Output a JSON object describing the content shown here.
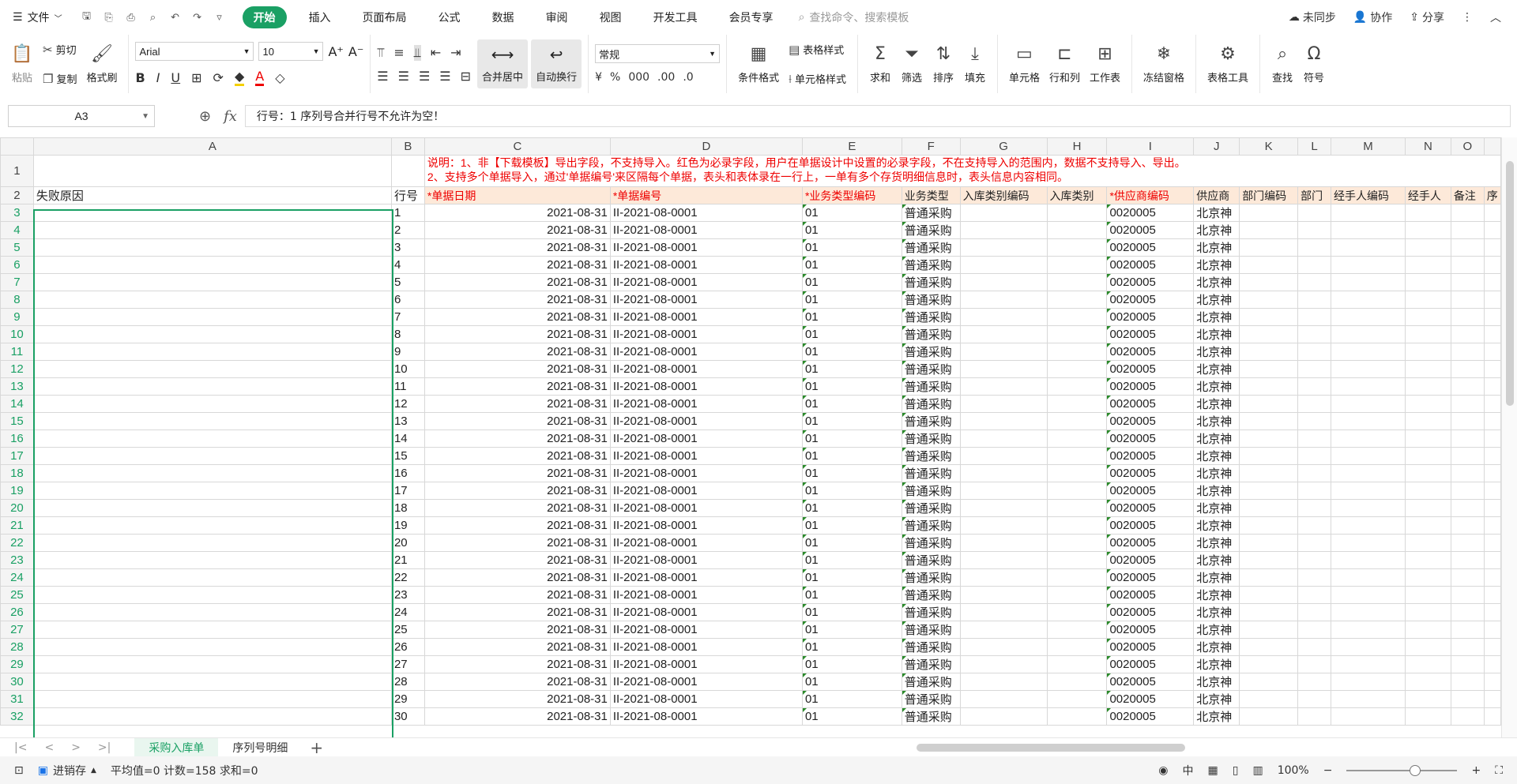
{
  "menubar": {
    "file_label": "文件",
    "tabs": [
      "开始",
      "插入",
      "页面布局",
      "公式",
      "数据",
      "审阅",
      "视图",
      "开发工具",
      "会员专享"
    ],
    "active_tab": "开始",
    "search_placeholder": "查找命令、搜索模板",
    "right": {
      "sync": "未同步",
      "collab": "协作",
      "share": "分享"
    }
  },
  "ribbon": {
    "paste": "粘贴",
    "cut": "剪切",
    "copy": "复制",
    "format_painter": "格式刷",
    "font_name": "Arial",
    "font_size": "10",
    "merge_center": "合并居中",
    "wrap_text": "自动换行",
    "number_format": "常规",
    "cond_format": "条件格式",
    "table_style": "表格样式",
    "cell_style": "单元格样式",
    "sum": "求和",
    "filter": "筛选",
    "sort": "排序",
    "fill": "填充",
    "cell": "单元格",
    "row_col": "行和列",
    "worksheet": "工作表",
    "freeze": "冻结窗格",
    "table_tools": "表格工具",
    "find": "查找",
    "symbol": "符号"
  },
  "formulabar": {
    "namebox": "A3",
    "fx_label": "fx",
    "formula": "行号：1 序列号合并行号不允许为空！"
  },
  "sheet": {
    "columns": [
      "A",
      "B",
      "C",
      "D",
      "E",
      "F",
      "G",
      "H",
      "I",
      "J",
      "K",
      "L",
      "M",
      "N",
      "O"
    ],
    "note_line1": "说明：1、非【下载模板】导出字段，不支持导入。红色为必录字段，用户在单据设计中设置的必录字段，不在支持导入的范围内，数据不支持导入、导出。",
    "note_line2": "2、支持多个单据导入，通过'单据编号'来区隔每个单据，表头和表体录在一行上，一单有多个存货明细信息时，表头信息内容相同。",
    "header_row": {
      "a": "失败原因",
      "b": "行号",
      "c": "*单据日期",
      "d": "*单据编号",
      "e": "*业务类型编码",
      "f": "业务类型",
      "g": "入库类别编码",
      "h": "入库类别",
      "i": "*供应商编码",
      "j": "供应商",
      "k": "部门编码",
      "l": "部门",
      "m": "经手人编码",
      "n": "经手人",
      "o": "备注",
      "p": "序"
    },
    "data_row_template": {
      "date": "2021-08-31",
      "doc_no": "II-2021-08-0001",
      "biz_code": "01",
      "biz_type": "普通采购",
      "vendor_code": "0020005",
      "vendor": "北京神"
    },
    "row_numbers": [
      "3",
      "4",
      "5",
      "6",
      "7",
      "8",
      "9",
      "10",
      "11",
      "12",
      "13",
      "14",
      "15",
      "16",
      "17",
      "18",
      "19",
      "20",
      "21",
      "22",
      "23",
      "24",
      "25",
      "26",
      "27",
      "28",
      "29",
      "30",
      "31",
      "32"
    ],
    "line_numbers": [
      "1",
      "2",
      "3",
      "4",
      "5",
      "6",
      "7",
      "8",
      "9",
      "10",
      "11",
      "12",
      "13",
      "14",
      "15",
      "16",
      "17",
      "18",
      "19",
      "20",
      "21",
      "22",
      "23",
      "24",
      "25",
      "26",
      "27",
      "28",
      "29",
      "30"
    ]
  },
  "sheet_tabs": [
    "采购入库单",
    "序列号明细"
  ],
  "active_sheet": "采购入库单",
  "statusbar": {
    "mode": "进销存",
    "stats": "平均值=0  计数=158  求和=0",
    "zoom": "100%"
  },
  "colors": {
    "accent": "#1aa064",
    "required": "#e00000",
    "header_fill": "#fde9d9"
  }
}
